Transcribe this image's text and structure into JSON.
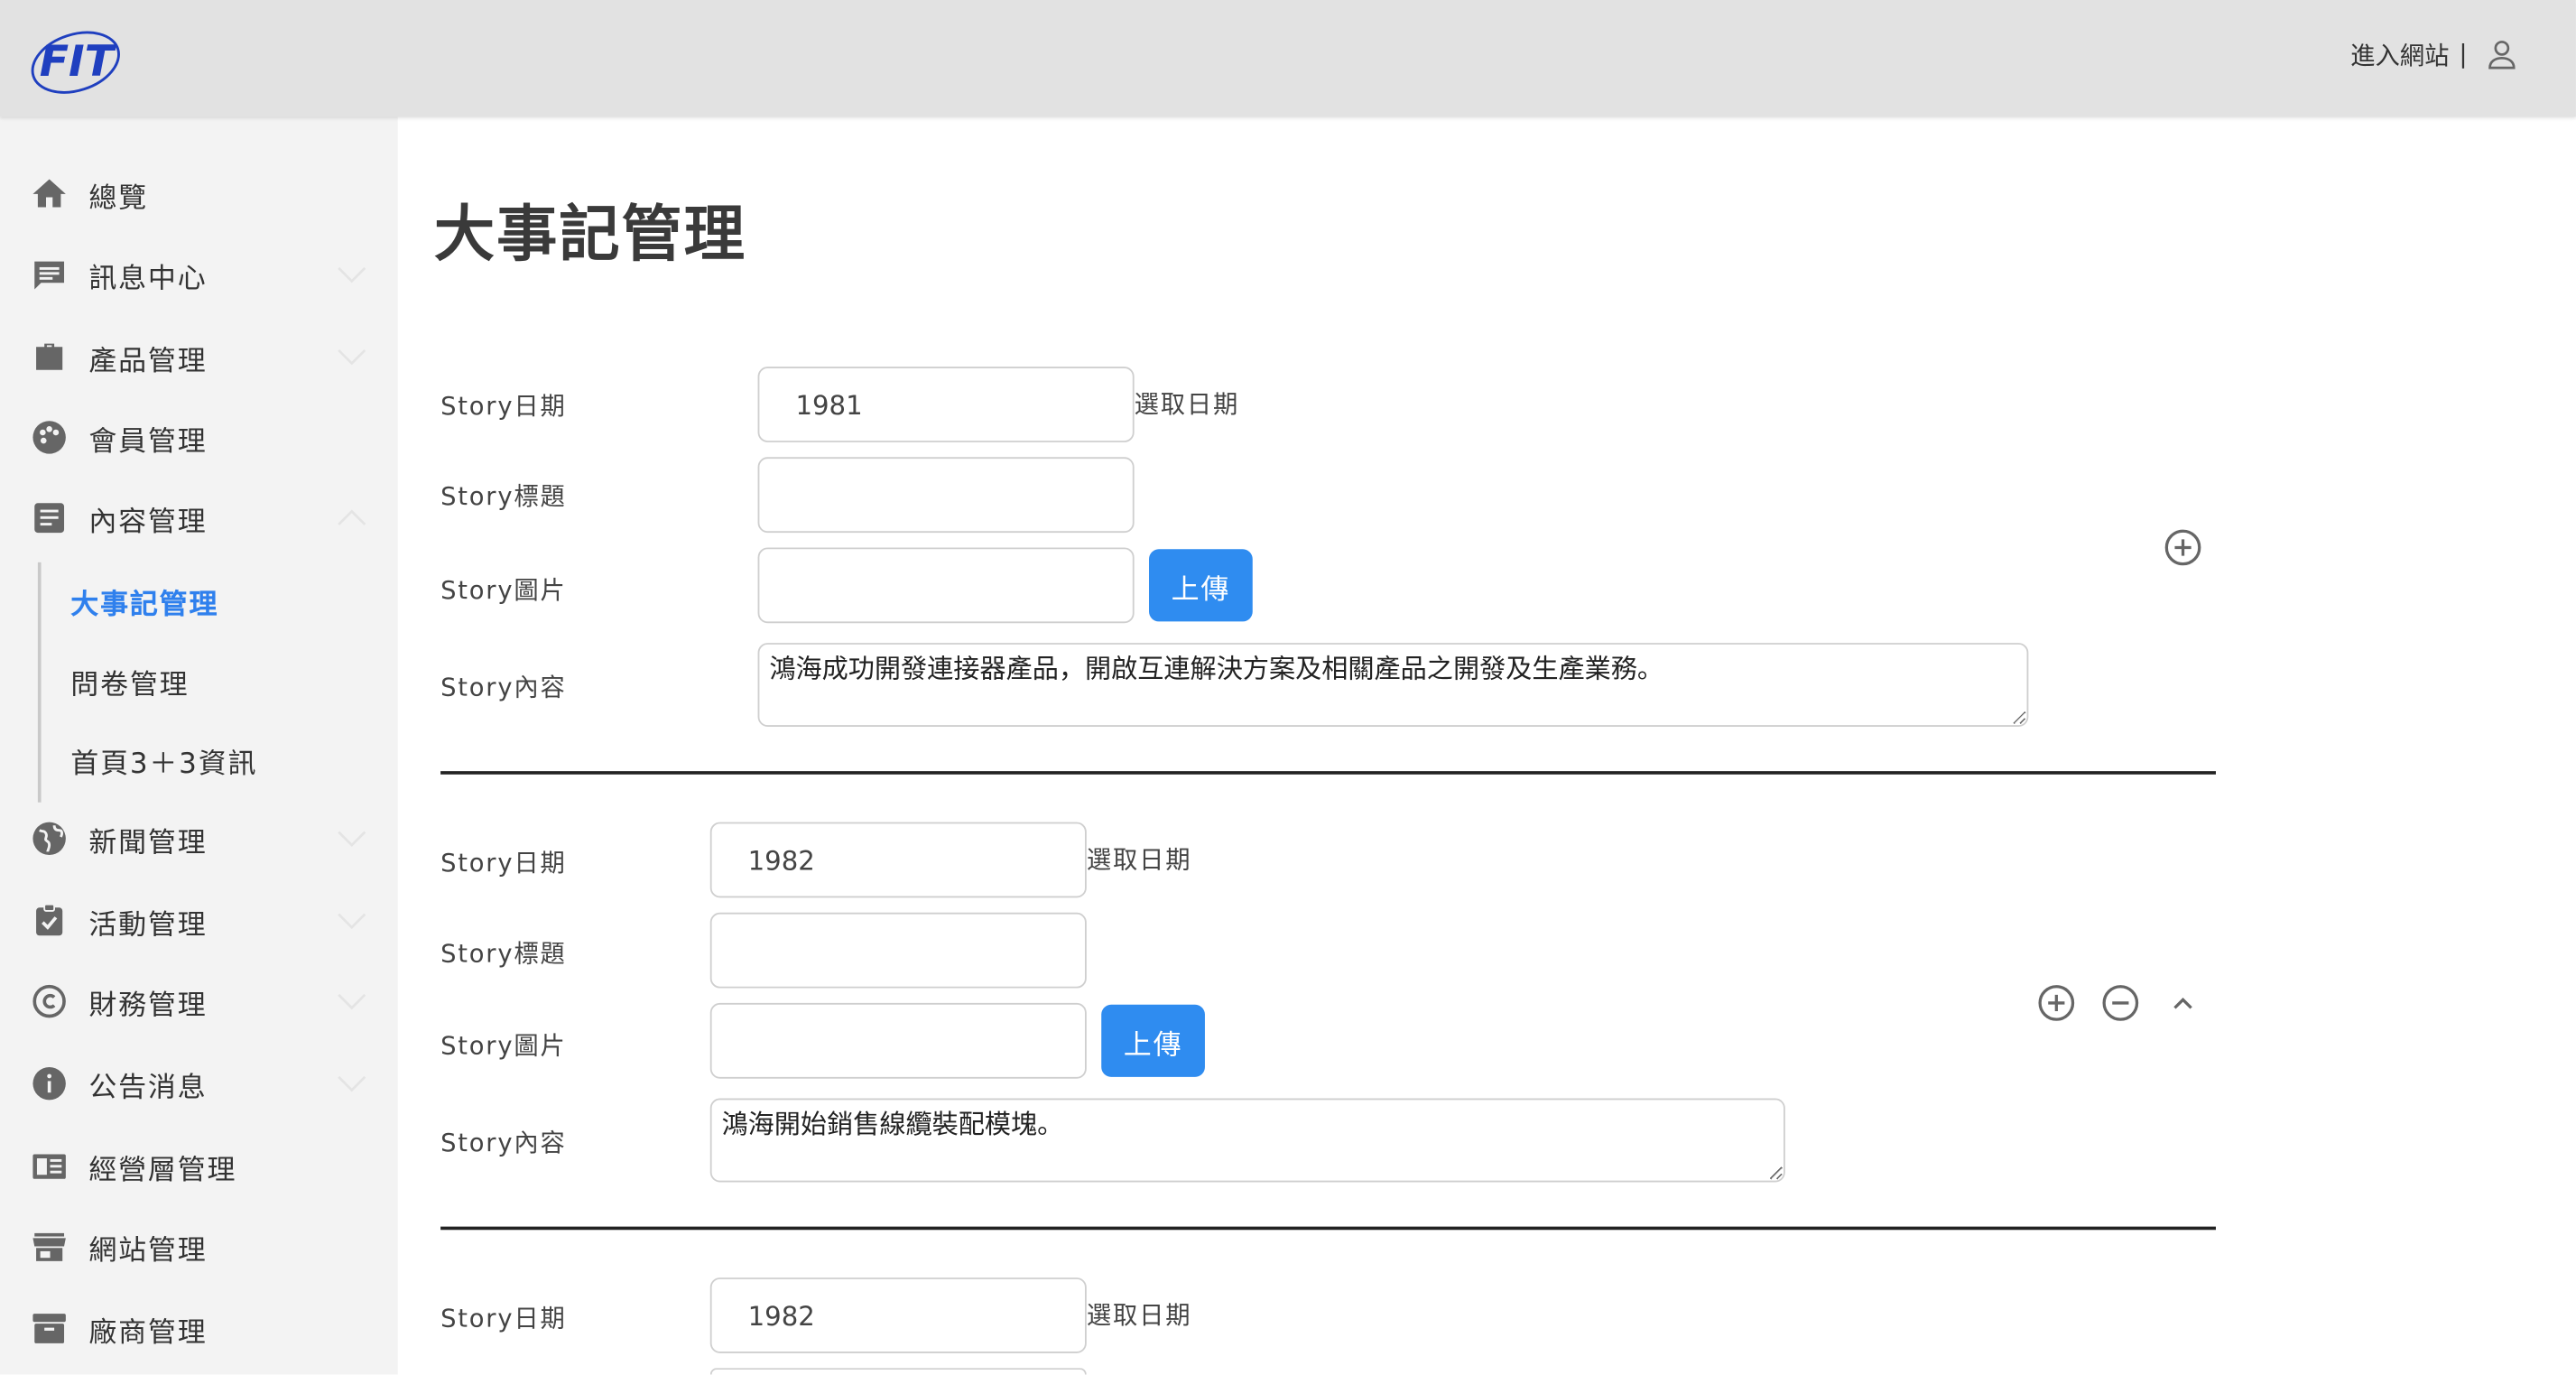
{
  "header": {
    "brand": "FIT",
    "enter_site": "進入網站",
    "separator": "|"
  },
  "sidebar": {
    "items": [
      {
        "label": "總覽",
        "icon": "home-icon"
      },
      {
        "label": "訊息中心",
        "icon": "message-icon"
      },
      {
        "label": "產品管理",
        "icon": "briefcase-icon"
      },
      {
        "label": "會員管理",
        "icon": "palette-icon"
      },
      {
        "label": "內容管理",
        "icon": "document-icon"
      },
      {
        "label": "新聞管理",
        "icon": "globe-icon"
      },
      {
        "label": "活動管理",
        "icon": "clipboard-check-icon"
      },
      {
        "label": "財務管理",
        "icon": "copyright-icon"
      },
      {
        "label": "公告消息",
        "icon": "info-icon"
      },
      {
        "label": "經營層管理",
        "icon": "newspaper-icon"
      },
      {
        "label": "網站管理",
        "icon": "storefront-icon"
      },
      {
        "label": "廠商管理",
        "icon": "archive-icon"
      }
    ],
    "subitems": [
      {
        "label": "大事記管理",
        "active": true
      },
      {
        "label": "問卷管理",
        "active": false
      },
      {
        "label": "首頁3＋3資訊",
        "active": false
      }
    ]
  },
  "main": {
    "title": "大事記管理",
    "labels": {
      "date": "Story日期",
      "title": "Story標題",
      "image": "Story圖片",
      "content": "Story內容",
      "pick_date": "選取日期",
      "upload": "上傳"
    },
    "stories": [
      {
        "date": "1981",
        "title": "",
        "image": "",
        "content": "鴻海成功開發連接器產品，開啟互連解決方案及相關產品之開發及生產業務。"
      },
      {
        "date": "1982",
        "title": "",
        "image": "",
        "content": "鴻海開始銷售線纜裝配模塊。"
      },
      {
        "date": "1982"
      }
    ]
  },
  "colors": {
    "accent": "#2f8cf0",
    "active_nav": "#2f80ed",
    "topbar_bg": "#e2e2e2",
    "sidebar_bg": "#f3f3f3"
  }
}
